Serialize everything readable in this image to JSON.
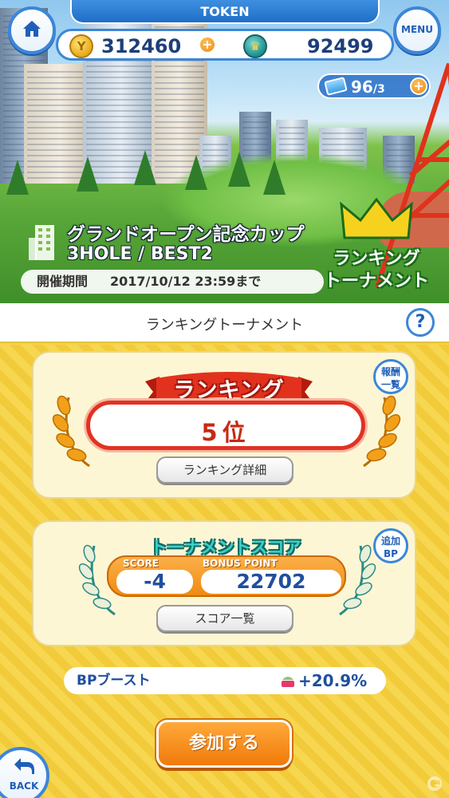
{
  "header": {
    "title": "TOKEN",
    "menu_label": "MENU",
    "gold_coins": "312460",
    "teal_coins": "92499",
    "tickets_current": "96",
    "tickets_max": "/3"
  },
  "event": {
    "name": "グランドオープン記念カップ",
    "format": "3HOLE / BEST2",
    "period_label": "開催期間",
    "period_value": "2017/10/12 23:59まで",
    "badge_line1": "ランキング",
    "badge_line2": "トーナメント"
  },
  "section": {
    "title": "ランキングトーナメント",
    "help": "?"
  },
  "ranking_card": {
    "ribbon": "ランキング",
    "rank": "5位",
    "detail_button": "ランキング詳細",
    "reward_button_line1": "報酬",
    "reward_button_line2": "一覧"
  },
  "score_card": {
    "ribbon": "トーナメントスコア",
    "score_label": "SCORE",
    "score_value": "-4",
    "bonus_label": "BONUS POINT",
    "bonus_value": "22702",
    "list_button": "スコア一覧",
    "add_bp_line1": "追加",
    "add_bp_line2": "BP"
  },
  "boost": {
    "label": "BPブースト",
    "value": "+20.9%"
  },
  "actions": {
    "join": "参加する",
    "back": "BACK"
  },
  "colors": {
    "primary_blue": "#3c86d8",
    "accent_orange": "#f08a10",
    "rank_red": "#e23222",
    "background_yellow": "#f5d24a"
  }
}
